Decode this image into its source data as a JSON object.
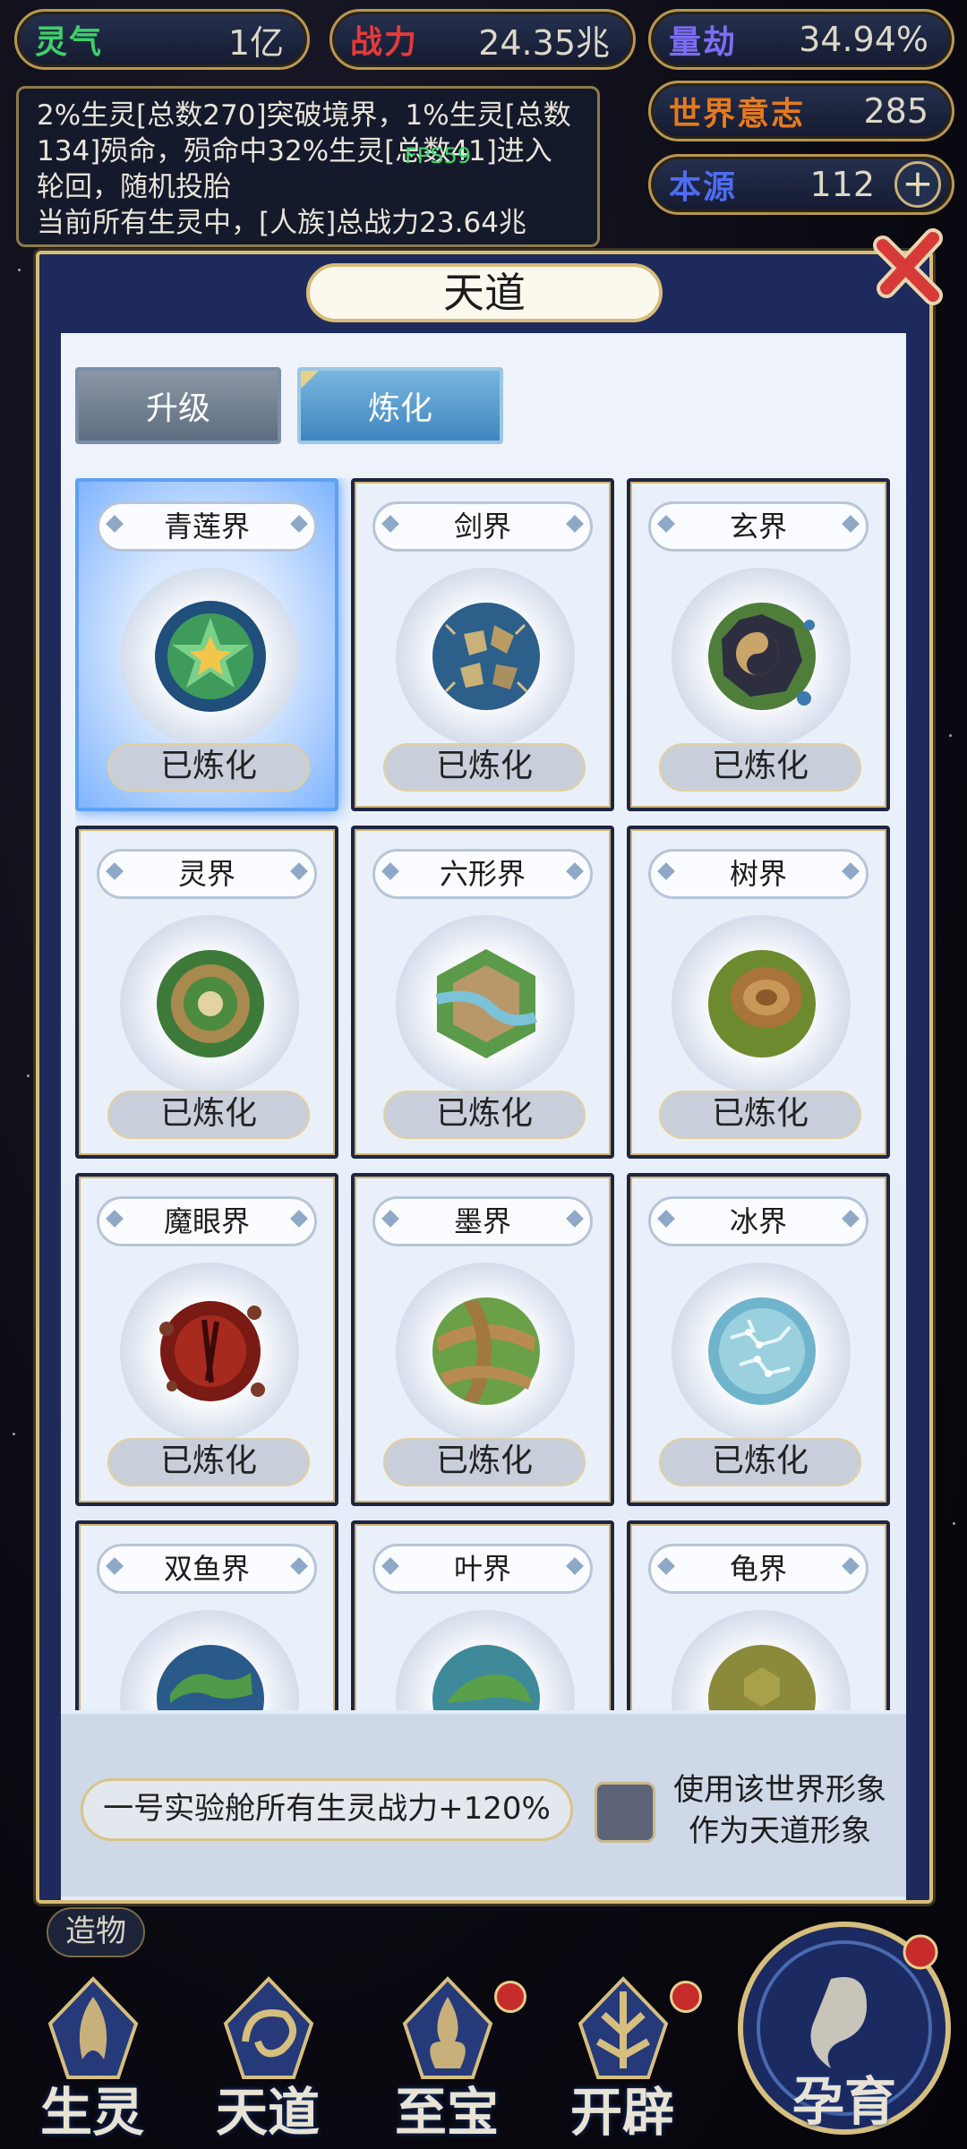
{
  "stats": {
    "lingqi": {
      "label": "灵气",
      "value": "1亿"
    },
    "zhanli": {
      "label": "战力",
      "value": "24.35兆"
    },
    "liangjie": {
      "label": "量劫",
      "value": "34.94%"
    },
    "world_will": {
      "label": "世界意志",
      "value": "285"
    },
    "benyuan": {
      "label": "本源",
      "value": "112"
    }
  },
  "log": {
    "line1": "2%生灵[总数270]突破境界，1%生灵[总数134]殒命，殒命中32%生灵[总数41]进入轮回，随机投胎",
    "line2": "当前所有生灵中，[人族]总战力23.64兆"
  },
  "fps": "FPS59",
  "panel": {
    "title": "天道"
  },
  "tabs": {
    "upgrade": "升级",
    "refine": "炼化"
  },
  "worlds": [
    {
      "name": "青莲界",
      "status": "已炼化"
    },
    {
      "name": "剑界",
      "status": "已炼化"
    },
    {
      "name": "玄界",
      "status": "已炼化"
    },
    {
      "name": "灵界",
      "status": "已炼化"
    },
    {
      "name": "六形界",
      "status": "已炼化"
    },
    {
      "name": "树界",
      "status": "已炼化"
    },
    {
      "name": "魔眼界",
      "status": "已炼化"
    },
    {
      "name": "墨界",
      "status": "已炼化"
    },
    {
      "name": "冰界",
      "status": "已炼化"
    },
    {
      "name": "双鱼界",
      "status": ""
    },
    {
      "name": "叶界",
      "status": ""
    },
    {
      "name": "龟界",
      "status": ""
    }
  ],
  "bonus_text": "一号实验舱所有生灵战力+120%",
  "checkbox_label_line1": "使用该世界形象",
  "checkbox_label_line2": "作为天道形象",
  "zaowu_label": "造物",
  "nav": {
    "shengling": "生灵",
    "tiandao": "天道",
    "zhibao": "至宝",
    "kaipi": "开辟",
    "yunyu": "孕育"
  }
}
